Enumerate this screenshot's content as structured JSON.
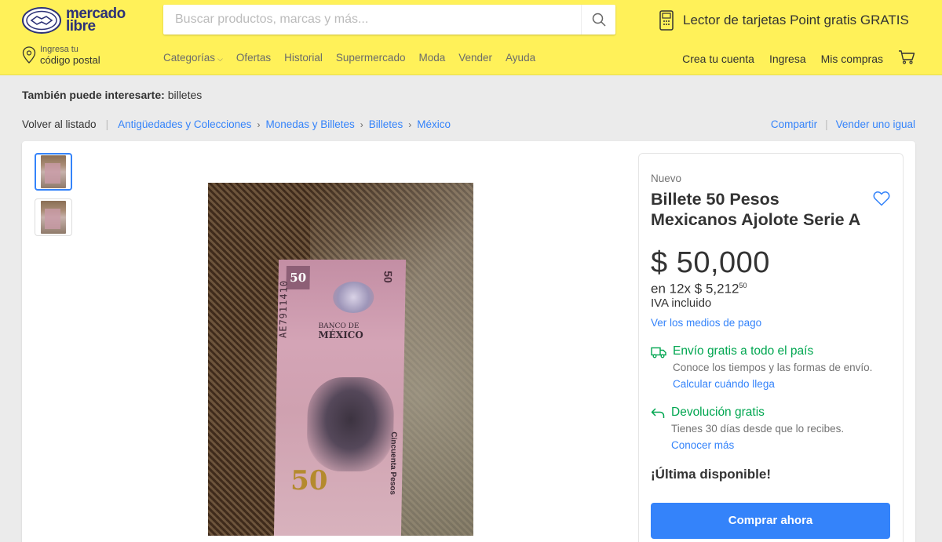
{
  "header": {
    "logo": {
      "line1": "mercado",
      "line2": "libre"
    },
    "search": {
      "placeholder": "Buscar productos, marcas y más..."
    },
    "promo_text": "Lector de tarjetas Point gratis GRATIS",
    "postal": {
      "small": "Ingresa tu",
      "big": "código postal"
    },
    "nav": [
      "Categorías",
      "Ofertas",
      "Historial",
      "Supermercado",
      "Moda",
      "Vender",
      "Ayuda"
    ],
    "user_nav": [
      "Crea tu cuenta",
      "Ingresa",
      "Mis compras"
    ]
  },
  "related": {
    "label": "También puede interesarte:",
    "value": "billetes"
  },
  "breadcrumb": {
    "back": "Volver al listado",
    "items": [
      "Antigüedades y Colecciones",
      "Monedas y Billetes",
      "Billetes",
      "México"
    ]
  },
  "actions": {
    "share": "Compartir",
    "sell_same": "Vender uno igual"
  },
  "product": {
    "condition": "Nuevo",
    "title": "Billete 50 Pesos Mexicanos Ajolote Serie A",
    "price": "$ 50,000",
    "installments_prefix": "en 12x $ 5,212",
    "installments_cents": "50",
    "iva": "IVA incluido",
    "payment_link": "Ver los medios de pago",
    "shipping": {
      "title": "Envío gratis a todo el país",
      "desc": "Conoce los tiempos y las formas de envío.",
      "link": "Calcular cuándo llega"
    },
    "returns": {
      "title": "Devolución gratis",
      "desc": "Tienes 30 días desde que lo recibes.",
      "link": "Conocer más"
    },
    "stock_label": "¡Última disponible!",
    "buy_button": "Comprar ahora"
  },
  "banknote_photo": {
    "denomination": "50",
    "bank_line1": "BANCO DE",
    "bank_line2": "MÉXICO",
    "serial": "AE7911410",
    "side_text": "Cincuenta Pesos"
  },
  "colors": {
    "header_bg": "#fff159",
    "link_blue": "#3483fa",
    "green": "#00a650",
    "logo_blue": "#2d3277"
  },
  "icons": [
    "handshake-logo-icon",
    "search-icon",
    "card-reader-icon",
    "location-pin-icon",
    "chevron-down-icon",
    "cart-icon",
    "heart-icon",
    "truck-icon",
    "return-arrow-icon",
    "chevron-right-icon"
  ]
}
